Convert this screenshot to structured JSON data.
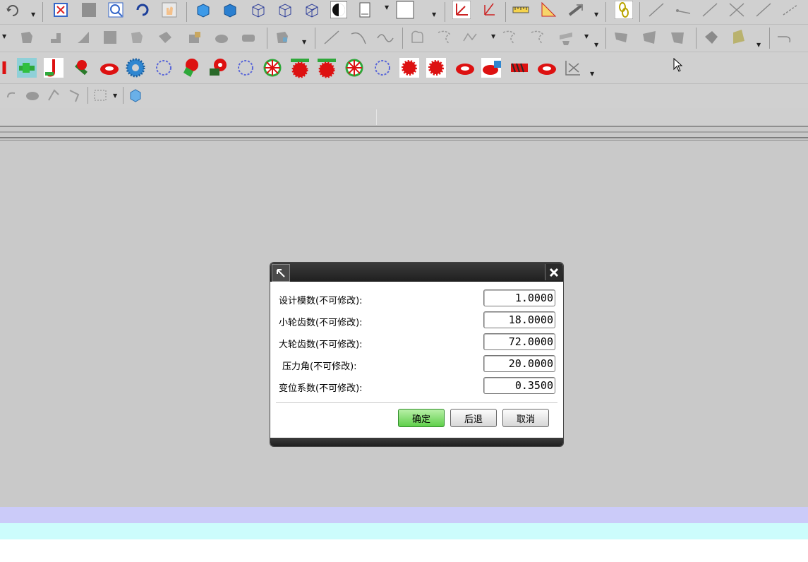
{
  "dialog": {
    "fields": [
      {
        "label": "设计模数(不可修改):",
        "value": "1.0000"
      },
      {
        "label": "小轮齿数(不可修改):",
        "value": "18.0000"
      },
      {
        "label": "大轮齿数(不可修改):",
        "value": "72.0000"
      },
      {
        "label": "压力角(不可修改):",
        "value": "20.0000"
      },
      {
        "label": "变位系数(不可修改):",
        "value": "0.3500"
      }
    ],
    "buttons": {
      "ok": "确定",
      "back": "后退",
      "cancel": "取消"
    }
  },
  "colors": {
    "band_lavender": "#cbcbf9",
    "band_cyan": "#ccfcfc",
    "ok_green": "#5fcf4a"
  },
  "icons": [
    "undo-icon",
    "fit-view-icon",
    "zoom-window-icon",
    "rotate-icon",
    "pan-icon",
    "shaded-cube-icon",
    "wireframe-cube-icon",
    "render-style-icon",
    "layer-icon",
    "measure-icon",
    "snap-icon",
    "gear-icon",
    "spline-icon",
    "surface-icon"
  ]
}
